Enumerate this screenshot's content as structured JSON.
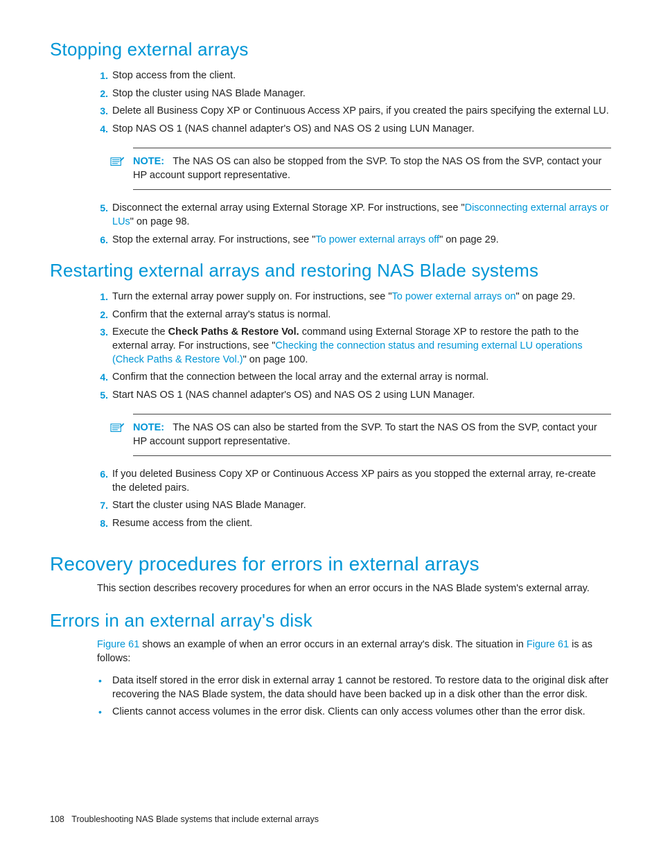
{
  "h_stopping": "Stopping external arrays",
  "stop_list": {
    "i1": "Stop access from the client.",
    "i2": "Stop the cluster using NAS Blade Manager.",
    "i3": "Delete all Business Copy XP or Continuous Access XP pairs, if you created the pairs specifying the external LU.",
    "i4": "Stop NAS OS 1 (NAS channel adapter's OS) and NAS OS 2 using LUN Manager.",
    "i5_pre": "Disconnect the external array using External Storage XP. For instructions, see \"",
    "i5_link": "Disconnecting external arrays or LUs",
    "i5_post": "\" on page 98.",
    "i6_pre": "Stop the external array. For instructions, see \"",
    "i6_link": "To power external arrays off",
    "i6_post": "\" on page 29."
  },
  "note1_label": "NOTE:",
  "note1_text": "The NAS OS can also be stopped from the SVP. To stop the NAS OS from the SVP, contact your HP account support representative.",
  "h_restarting": "Restarting external arrays and restoring NAS Blade systems",
  "restart_list": {
    "i1_pre": "Turn the external array power supply on. For instructions, see \"",
    "i1_link": "To power external arrays on",
    "i1_post": "\" on page 29.",
    "i2": "Confirm that the external array's status is normal.",
    "i3_pre": "Execute the ",
    "i3_bold": "Check Paths & Restore Vol.",
    "i3_mid": " command using External Storage XP to restore the path to the external array. For instructions, see \"",
    "i3_link": "Checking the connection status and resuming external LU operations (Check Paths & Restore Vol.)",
    "i3_post": "\" on page 100.",
    "i4": "Confirm that the connection between the local array and the external array is normal.",
    "i5": "Start NAS OS 1 (NAS channel adapter's OS) and NAS OS 2 using LUN Manager.",
    "i6": "If you deleted Business Copy XP or Continuous Access XP pairs as you stopped the external array, re-create the deleted pairs.",
    "i7": "Start the cluster using NAS Blade Manager.",
    "i8": "Resume access from the client."
  },
  "note2_label": "NOTE:",
  "note2_text": "The NAS OS can also be started from the SVP. To start the NAS OS from the SVP, contact your HP account support representative.",
  "h_recovery": "Recovery procedures for errors in external arrays",
  "recovery_intro": "This section describes recovery procedures for when an error occurs in the NAS Blade system's external array.",
  "h_errors": "Errors in an external array's disk",
  "errors_p_link1": "Figure 61",
  "errors_p_mid": " shows an example of when an error occurs in an external array's disk. The situation in ",
  "errors_p_link2": "Figure 61",
  "errors_p_post": " is as follows:",
  "bullets": {
    "b1": "Data itself stored in the error disk in external array 1 cannot be restored. To restore data to the original disk after recovering the NAS Blade system, the data should have been backed up in a disk other than the error disk.",
    "b2": "Clients cannot access volumes in the error disk. Clients can only access volumes other than the error disk."
  },
  "footer_page": "108",
  "footer_text": "Troubleshooting NAS Blade systems that include external arrays"
}
